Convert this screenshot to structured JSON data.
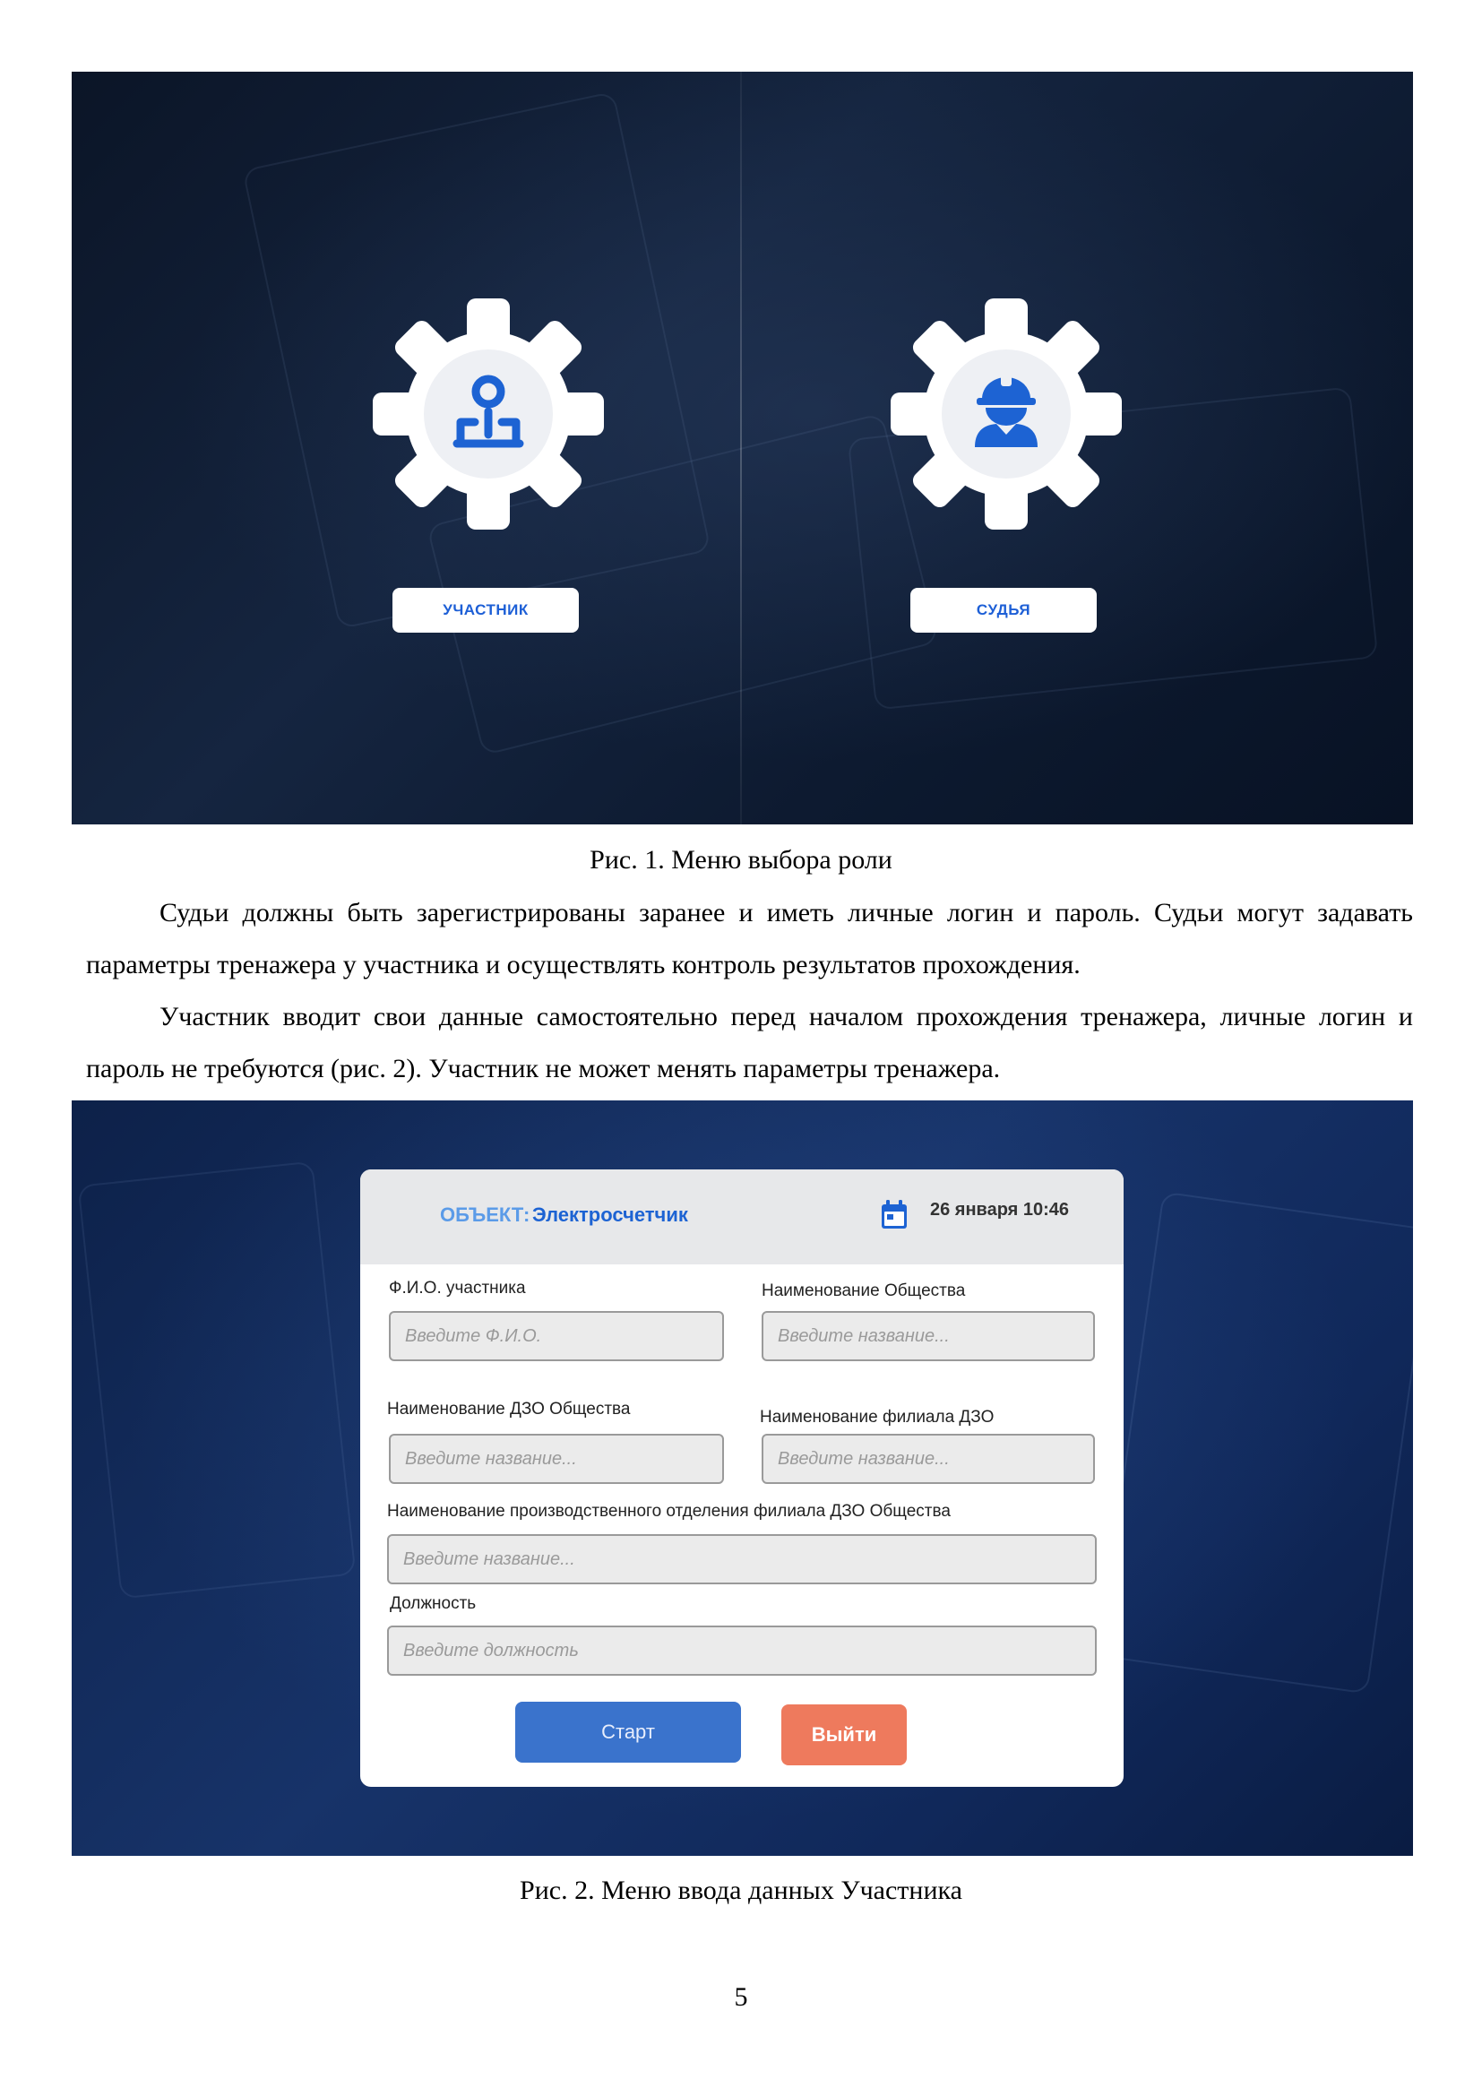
{
  "figure1": {
    "roles": [
      {
        "label": "УЧАСТНИК",
        "icon": "participant-icon"
      },
      {
        "label": "СУДЬЯ",
        "icon": "judge-icon"
      }
    ],
    "caption": "Рис. 1. Меню выбора роли"
  },
  "paragraphs": [
    "Судьи должны быть зарегистрированы заранее и иметь личные логин и пароль. Судьи могут задавать параметры тренажера у участника и осуществлять контроль результатов прохождения.",
    "Участник вводит свои данные самостоятельно перед началом прохождения тренажера, личные логин и пароль не требуются (рис. 2). Участник не может менять параметры тренажера."
  ],
  "figure2": {
    "header": {
      "object_label": "ОБЪЕКТ:",
      "object_value": "Электросчетчик",
      "date": "26 января 10:46"
    },
    "fields": {
      "fio": {
        "label": "Ф.И.О. участника",
        "placeholder": "Введите Ф.И.О."
      },
      "company": {
        "label": "Наименование Общества",
        "placeholder": "Введите название..."
      },
      "dzo": {
        "label": "Наименование ДЗО Общества",
        "placeholder": "Введите название..."
      },
      "branch": {
        "label": "Наименование филиала ДЗО",
        "placeholder": "Введите название..."
      },
      "division": {
        "label": "Наименование производственного отделения филиала ДЗО Общества",
        "placeholder": "Введите название..."
      },
      "position": {
        "label": "Должность",
        "placeholder": "Введите должность"
      }
    },
    "buttons": {
      "start": "Старт",
      "exit": "Выйти"
    },
    "caption": "Рис. 2. Меню ввода данных Участника"
  },
  "page_number": "5",
  "colors": {
    "accent_blue": "#1d63d3",
    "start_button": "#3a73cc",
    "exit_button": "#ee7a5d"
  }
}
